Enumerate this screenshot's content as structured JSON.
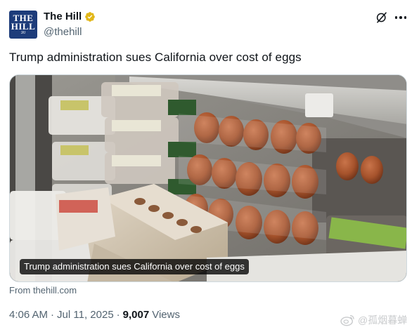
{
  "author": {
    "avatar_line1": "THE",
    "avatar_line2": "HILL",
    "avatar_line3": "30",
    "name": "The Hill",
    "handle": "@thehill",
    "verified_color": "#e2b719"
  },
  "tweet": {
    "text": "Trump administration sues California over cost of eggs"
  },
  "media": {
    "caption": "Trump administration sues California over cost of eggs",
    "source": "From thehill.com"
  },
  "meta": {
    "time": "4:06 AM",
    "separator": "·",
    "date": "Jul 11, 2025",
    "views_count": "9,007",
    "views_label": "Views"
  },
  "watermark": {
    "text": "@孤烟暮蝉"
  },
  "icons": {
    "verified": "verified-badge-icon",
    "grok": "grok-icon",
    "more": "more-icon",
    "weibo": "weibo-icon"
  },
  "colors": {
    "accent_text": "#0f1419",
    "secondary_text": "#536471",
    "avatar_bg": "#1d3c7a"
  }
}
